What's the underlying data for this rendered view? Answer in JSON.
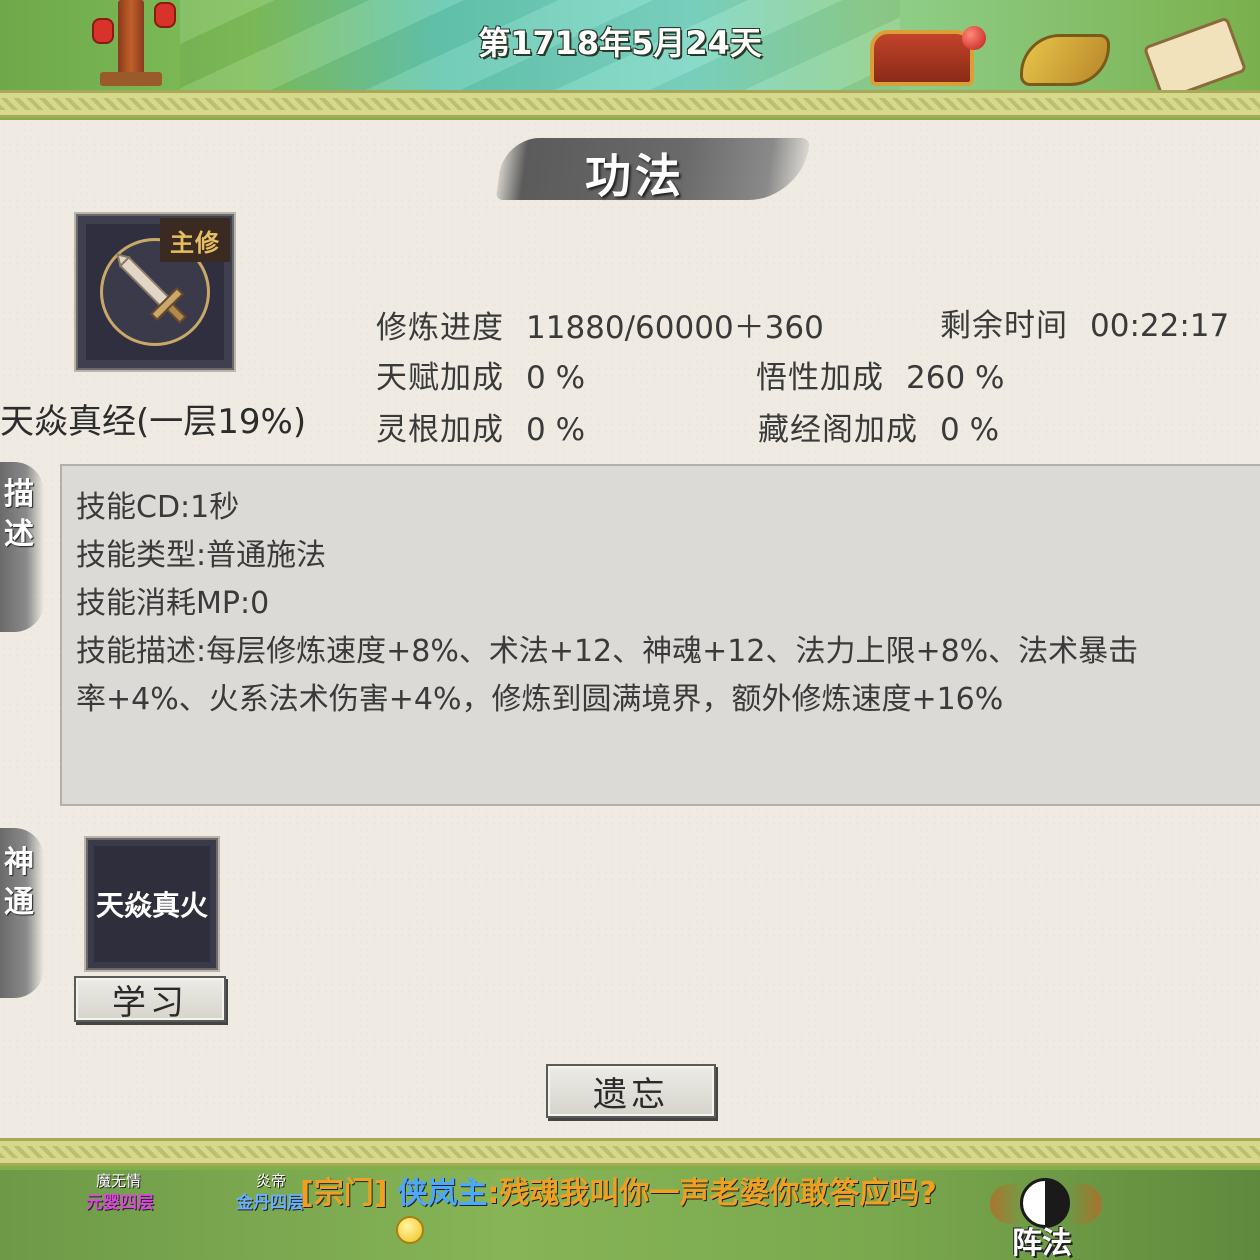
{
  "header": {
    "date": "第1718年5月24天"
  },
  "panel": {
    "title": "功法",
    "skill": {
      "badge": "主修",
      "icon": "sword-icon",
      "name": "天焱真经(一层19%)"
    },
    "stats": {
      "progress_label": "修炼进度",
      "progress_value": "11880/60000＋360",
      "remaining_label": "剩余时间",
      "remaining_value": "00:22:17",
      "talent_label": "天赋加成",
      "talent_value": "0 %",
      "comprehension_label": "悟性加成",
      "comprehension_value": "260 %",
      "spirit_root_label": "灵根加成",
      "spirit_root_value": "0 %",
      "library_label": "藏经阁加成",
      "library_value": "0 %"
    },
    "description": {
      "tab_label": [
        "描",
        "述"
      ],
      "lines": [
        "技能CD:1秒",
        "技能类型:普通施法",
        "技能消耗MP:0",
        "技能描述:每层修炼速度+8%、术法+12、神魂+12、法力上限+8%、法术暴击",
        "率+4%、火系法术伤害+4%，修炼到圆满境界，额外修炼速度+16%"
      ]
    },
    "divine": {
      "tab_label": [
        "神",
        "通"
      ],
      "skill_name": "天焱真火",
      "learn_button": "学习"
    },
    "forget_button": "遗忘"
  },
  "footer": {
    "npc1_name": "魔无情",
    "npc1_rank": "元婴四层",
    "npc2_name": "炎帝",
    "npc2_rank": "金丹四层",
    "chat_channel": "[宗门]",
    "chat_user": "侠岚主",
    "chat_message": ":残魂我叫你一声老婆你敢答应吗?",
    "formation_button": "阵法"
  },
  "colors": {
    "paper": "#efebe3",
    "desc_box": "#dcdad6",
    "border_strip": "#d6d88c",
    "chat_channel": "#f0a020",
    "chat_user": "#4aa8ff"
  }
}
